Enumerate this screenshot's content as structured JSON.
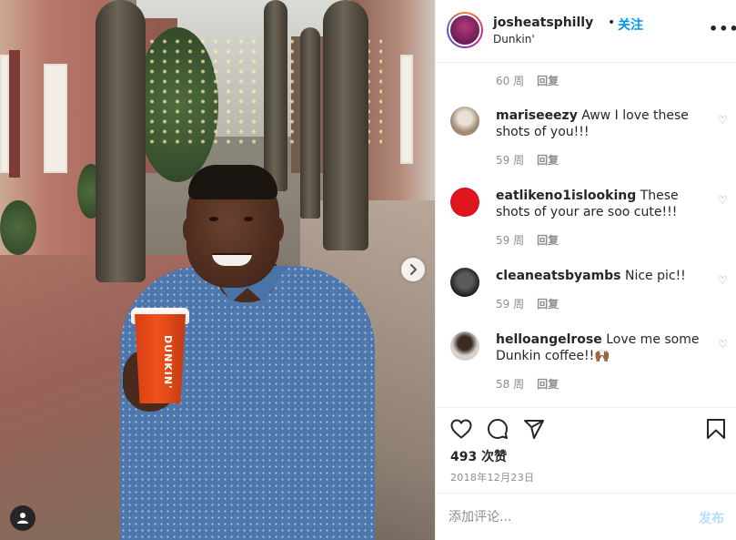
{
  "post": {
    "photo_alt": "",
    "cup_brand": "DUNKIN'",
    "username": "josheatsphilly",
    "separator": "•",
    "follow_label": "关注",
    "location": "Dunkin'",
    "more_icon": "more-horizontal-icon"
  },
  "comments": [
    {
      "username": "",
      "text": "",
      "age": "60 周",
      "reply_label": "回复",
      "meta_only": true
    },
    {
      "username": "mariseeezy",
      "text": "Aww I love these shots of you!!!",
      "age": "59 周",
      "reply_label": "回复",
      "avatar_colors": [
        "#a08a74",
        "#e9e1d6"
      ]
    },
    {
      "username": "eatlikeno1islooking",
      "text": "These shots of your are soo cute!!!",
      "age": "59 周",
      "reply_label": "回复",
      "avatar_colors": [
        "#e0161e",
        "#b90f15"
      ]
    },
    {
      "username": "cleaneatsbyambs",
      "text": "Nice pic!!",
      "age": "59 周",
      "reply_label": "回复",
      "avatar_colors": [
        "#2a2a2a",
        "#5a5a5a"
      ]
    },
    {
      "username": "helloangelrose",
      "text": "Love me some Dunkin coffee!!🙌🏾",
      "age": "58 周",
      "reply_label": "回复",
      "avatar_colors": [
        "#d6d2cc",
        "#3b2a22"
      ]
    }
  ],
  "actions": {
    "like_icon": "heart-outline-icon",
    "comment_icon": "comment-bubble-icon",
    "share_icon": "paper-plane-icon",
    "save_icon": "bookmark-icon",
    "likes_count": "493 次赞",
    "date": "2018年12月23日"
  },
  "add_comment": {
    "placeholder": "添加评论...",
    "post_label": "发布"
  },
  "colors": {
    "accent": "#0095f6",
    "post_button_disabled": "#b2dffc",
    "muted_text": "#8e8e8e",
    "divider": "#efefef"
  }
}
